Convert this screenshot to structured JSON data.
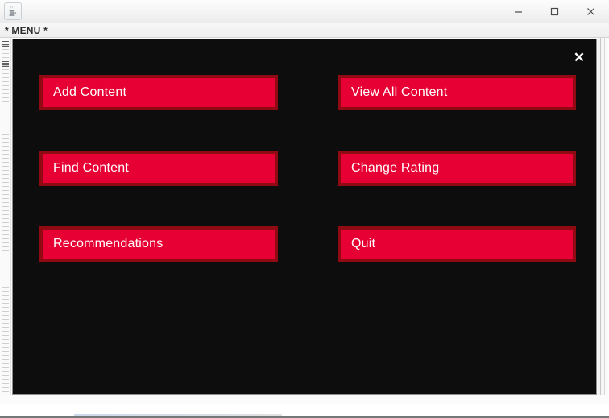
{
  "window": {
    "app_icon": "java-coffee-cup-icon",
    "title": "",
    "controls": {
      "minimize": "minimize-icon",
      "maximize": "maximize-icon",
      "close": "close-icon"
    }
  },
  "menubar": {
    "items": [
      {
        "label": "* MENU *"
      }
    ]
  },
  "panel": {
    "close_glyph": "✕",
    "background_color": "#0d0d0d",
    "buttons": [
      {
        "label": "Add Content",
        "column": "left",
        "row": 1
      },
      {
        "label": "View All Content",
        "column": "right",
        "row": 1
      },
      {
        "label": "Find Content",
        "column": "left",
        "row": 2
      },
      {
        "label": "Change Rating",
        "column": "right",
        "row": 2
      },
      {
        "label": "Recommendations",
        "column": "left",
        "row": 3
      },
      {
        "label": "Quit",
        "column": "right",
        "row": 3
      }
    ],
    "button_fill_color": "#e60033",
    "button_border_color": "#8f0a12",
    "button_text_color": "#ffffff"
  }
}
